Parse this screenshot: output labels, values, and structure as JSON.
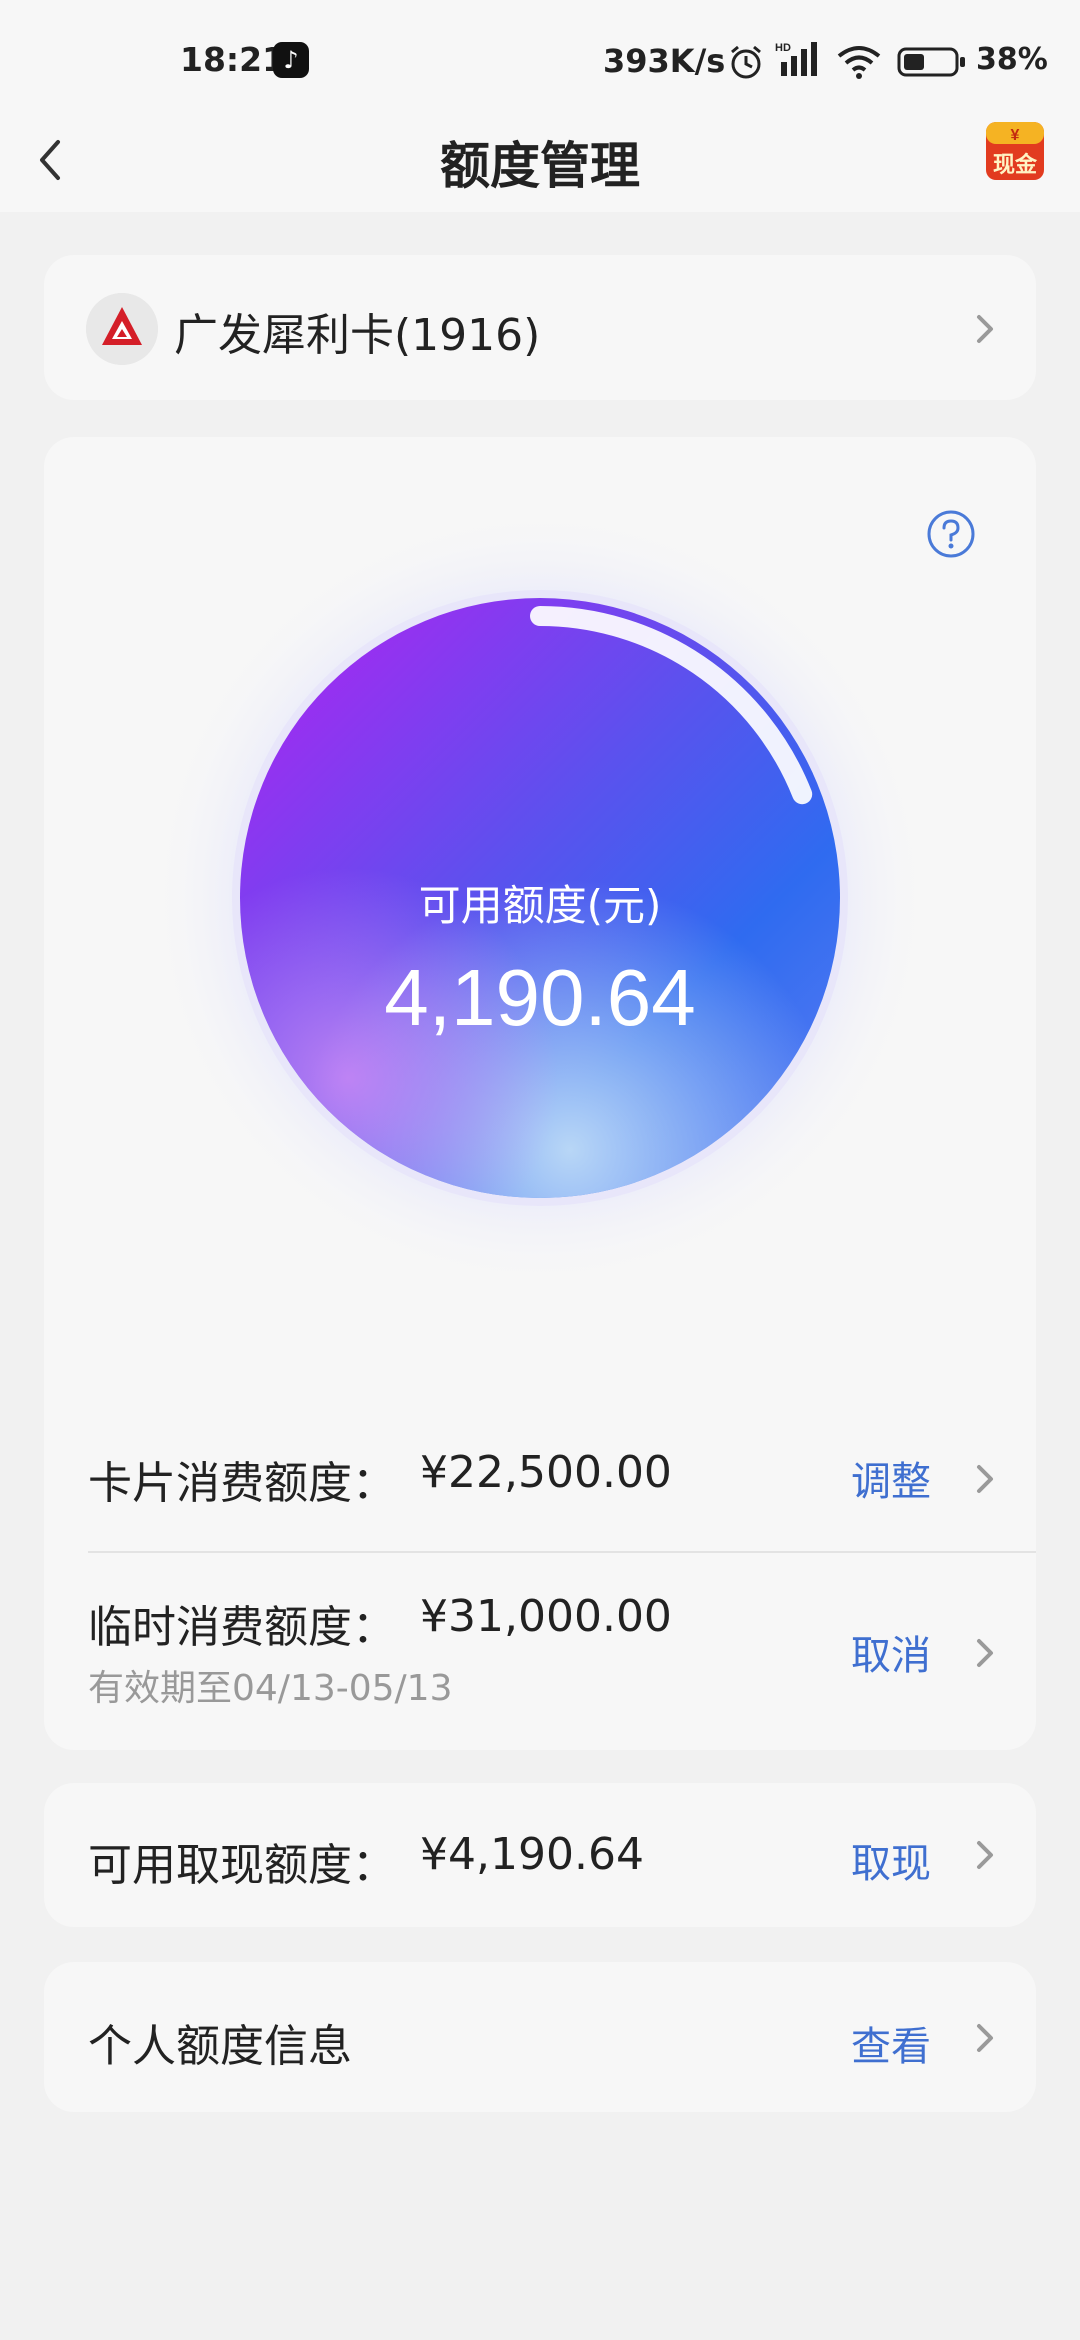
{
  "status_bar": {
    "time": "18:21",
    "net_speed": "393K/s",
    "battery": "38%",
    "hd_label": "HD",
    "icons": [
      "tiktok-icon",
      "alarm-icon",
      "signal-icon",
      "wifi-icon",
      "battery-icon"
    ]
  },
  "header": {
    "title": "额度管理",
    "back_icon": "back-arrow-icon",
    "cash_badge": "现金",
    "cash_symbol": "¥"
  },
  "card_selector": {
    "name": "广发犀利卡(1916)"
  },
  "credit": {
    "circle_label": "可用额度(元)",
    "available": "4,190.64",
    "used_ratio": 0.19
  },
  "rows": {
    "card_limit": {
      "label": "卡片消费额度：",
      "amount": "¥22,500.00",
      "action": "调整"
    },
    "temp_limit": {
      "label": "临时消费额度：",
      "amount": "¥31,000.00",
      "validity": "有效期至04/13-05/13",
      "action": "取消"
    },
    "cash_limit": {
      "label": "可用取现额度：",
      "amount": "¥4,190.64",
      "action": "取现"
    },
    "personal_info": {
      "label": "个人额度信息",
      "action": "查看"
    }
  },
  "colors": {
    "accent": "#3f6fd0",
    "circle_start": "#b321f2",
    "circle_mid": "#2f6bf0",
    "circle_end": "#9ec4f4",
    "bank_red": "#d41e28"
  }
}
